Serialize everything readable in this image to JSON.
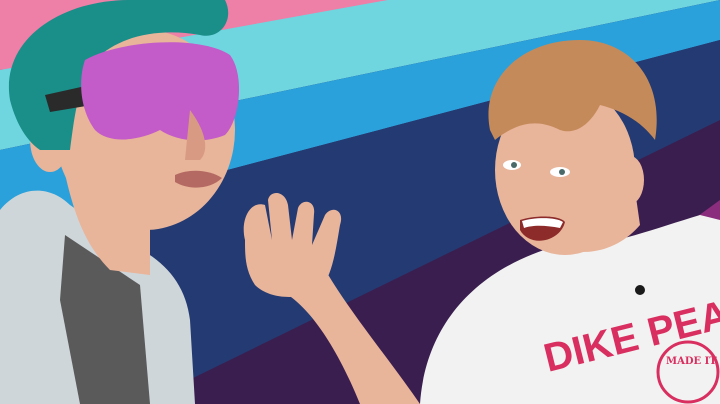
{
  "scene": {
    "colors": {
      "wall_top": "#ee7fa7",
      "wall_teal": "#6fd6e0",
      "wall_blue": "#2aa1db",
      "wall_navy": "#243a72",
      "wall_purple_dark": "#3a1e4f",
      "wall_magenta": "#8a2d7d",
      "blindfold": "#c35bc9",
      "hair_teal": "#1a8e89",
      "hair_blonde": "#c58a5a",
      "skin": "#e8b49a",
      "jacket": "#cfd6d9",
      "tshirt": "#f2f2f2",
      "tshirt_print": "#d92f60"
    },
    "shirt_print": {
      "line1": "DIKE PEA",
      "badge": "MADE IT"
    }
  }
}
